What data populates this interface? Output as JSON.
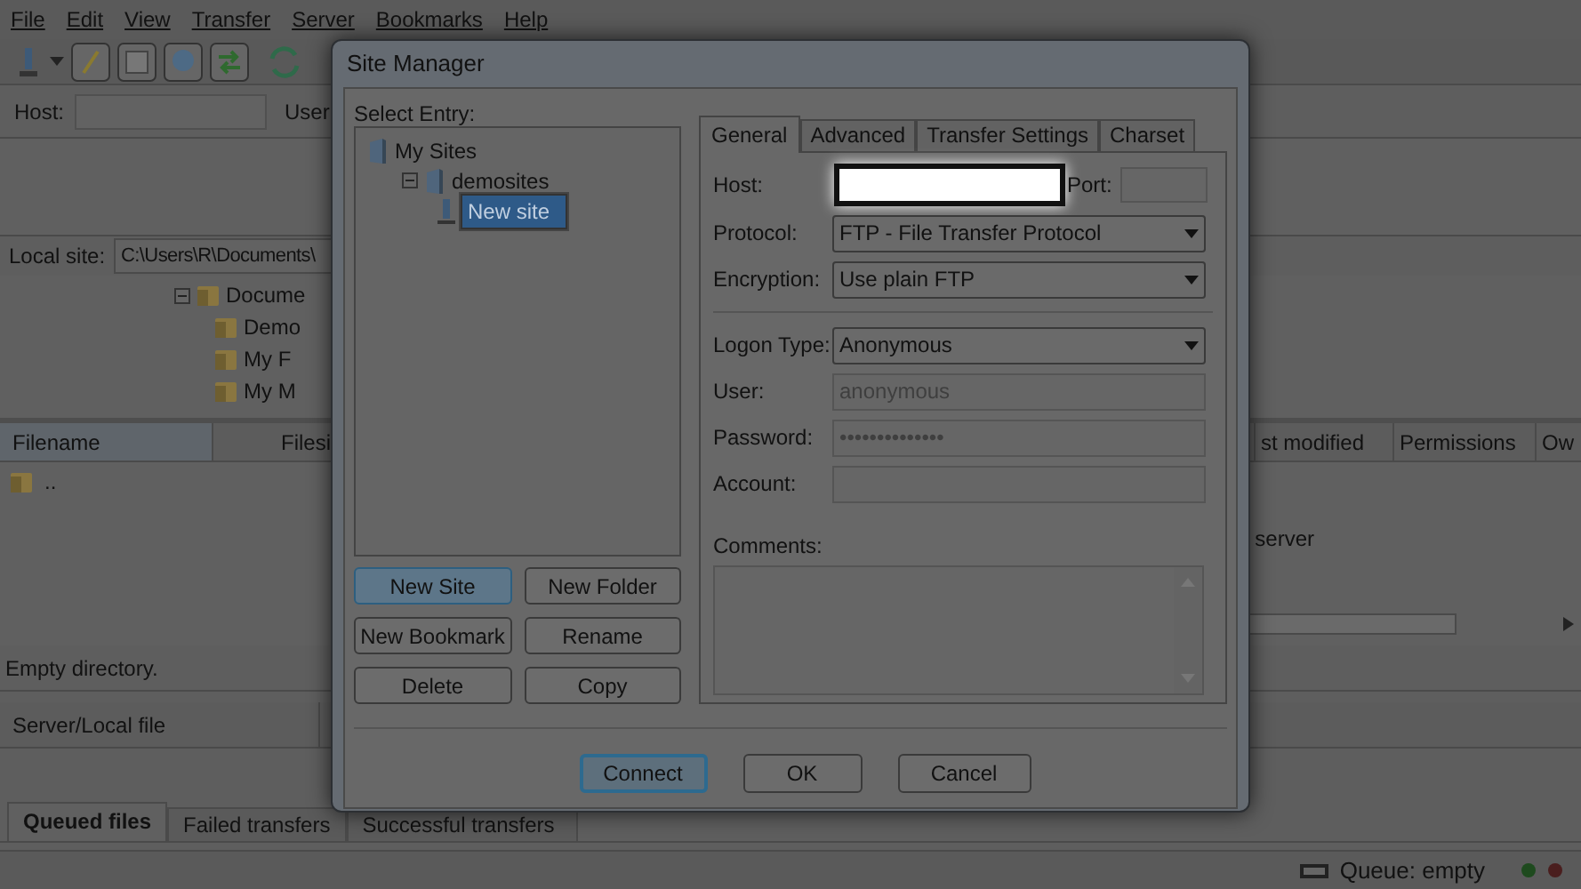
{
  "menu": [
    {
      "label": "File"
    },
    {
      "label": "Edit"
    },
    {
      "label": "View"
    },
    {
      "label": "Transfer"
    },
    {
      "label": "Server"
    },
    {
      "label": "Bookmarks"
    },
    {
      "label": "Help"
    }
  ],
  "quickconnect": {
    "host_label": "Host:",
    "user_label": "User"
  },
  "local_site": {
    "label": "Local site:",
    "path": "C:\\Users\\R\\Documents\\"
  },
  "local_tree": [
    {
      "label": "Docume",
      "expanded": true,
      "children": [
        {
          "label": "Demo"
        },
        {
          "label": "My F"
        },
        {
          "label": "My M"
        }
      ]
    }
  ],
  "local_list": {
    "columns": [
      "Filename",
      "Filesi"
    ],
    "rows": [
      ".."
    ],
    "status": "Empty directory."
  },
  "remote_list": {
    "columns": [
      "st modified",
      "Permissions",
      "Ow"
    ],
    "message": "server"
  },
  "queue": {
    "columns": [
      "Server/Local file"
    ],
    "tabs": [
      {
        "label": "Queued files",
        "selected": true
      },
      {
        "label": "Failed transfers",
        "selected": false
      },
      {
        "label": "Successful transfers",
        "selected": false
      }
    ]
  },
  "status_bar": {
    "queue": "Queue: empty"
  },
  "dialog": {
    "title": "Site Manager",
    "select_label": "Select Entry:",
    "tree": [
      {
        "label": "My Sites",
        "selected": false,
        "children": [
          {
            "label": "demosites",
            "expanded": true,
            "selected": false,
            "children": [
              {
                "label": "New site",
                "selected": true
              }
            ]
          }
        ]
      }
    ],
    "tree_buttons": [
      {
        "label": "New Site",
        "focused": true
      },
      {
        "label": "New Folder",
        "focused": false
      },
      {
        "label": "New Bookmark",
        "focused": false
      },
      {
        "label": "Rename",
        "focused": false
      },
      {
        "label": "Delete",
        "focused": false
      },
      {
        "label": "Copy",
        "focused": false
      }
    ],
    "tabs": [
      {
        "label": "General",
        "selected": true
      },
      {
        "label": "Advanced",
        "selected": false
      },
      {
        "label": "Transfer Settings",
        "selected": false
      },
      {
        "label": "Charset",
        "selected": false
      }
    ],
    "host": {
      "label": "Host:",
      "focused": true,
      "port_label": "Port:"
    },
    "fields": [
      {
        "kind": "select",
        "label": "Protocol:",
        "value": "FTP - File Transfer Protocol"
      },
      {
        "kind": "select",
        "label": "Encryption:",
        "value": "Use plain FTP"
      },
      {
        "kind": "separator"
      },
      {
        "kind": "select",
        "label": "Logon Type:",
        "value": "Anonymous"
      },
      {
        "kind": "text",
        "label": "User:",
        "value": "anonymous",
        "disabled": true
      },
      {
        "kind": "text",
        "label": "Password:",
        "value": "••••••••••••••",
        "disabled": true
      },
      {
        "kind": "text",
        "label": "Account:",
        "disabled": true
      }
    ],
    "comments_label": "Comments:",
    "buttons": [
      {
        "label": "Connect",
        "focused": true
      },
      {
        "label": "OK",
        "focused": false
      },
      {
        "label": "Cancel",
        "focused": false
      }
    ]
  }
}
